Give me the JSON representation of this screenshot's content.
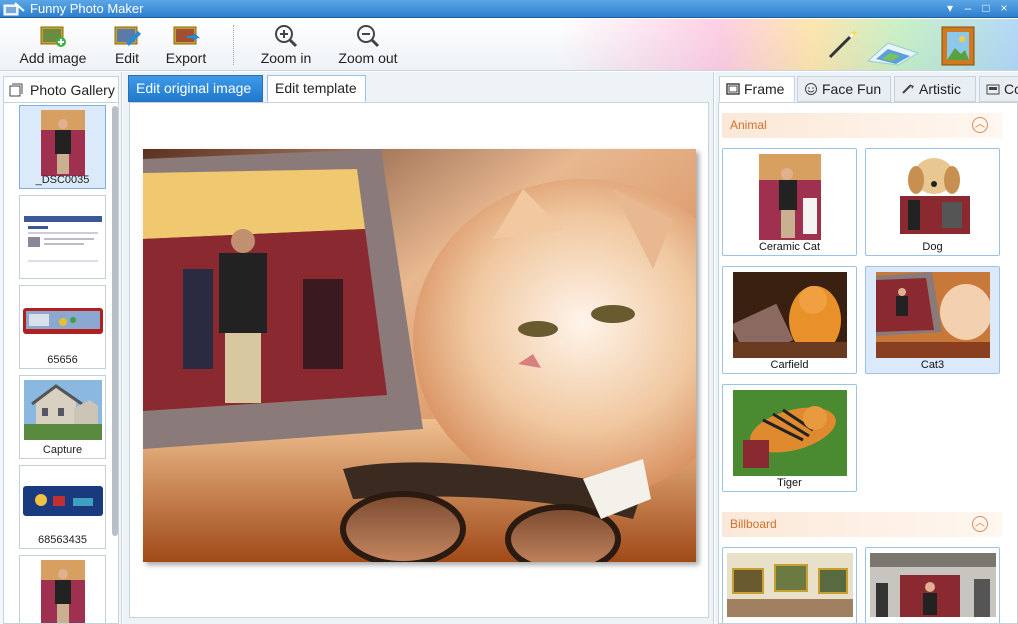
{
  "window": {
    "title": "Funny Photo Maker",
    "controls": [
      "▾",
      "–",
      "□",
      "×"
    ]
  },
  "toolbar": {
    "add_image": "Add image",
    "edit": "Edit",
    "export": "Export",
    "zoom_in": "Zoom in",
    "zoom_out": "Zoom out"
  },
  "gallery": {
    "tab_label": "Photo Gallery",
    "items": [
      {
        "caption": "_DSC0035",
        "selected": true
      },
      {
        "caption": "",
        "selected": false
      },
      {
        "caption": "65656",
        "selected": false
      },
      {
        "caption": "Capture",
        "selected": false
      },
      {
        "caption": "68563435",
        "selected": false
      },
      {
        "caption": "",
        "selected": false
      }
    ]
  },
  "editor": {
    "tab_original": "Edit original image",
    "tab_template": "Edit template"
  },
  "templates": {
    "tabs": [
      {
        "label": "Frame",
        "icon": "frame-icon",
        "active": true
      },
      {
        "label": "Face Fun",
        "icon": "smiley-icon",
        "active": false
      },
      {
        "label": "Artistic",
        "icon": "brush-icon",
        "active": false
      },
      {
        "label": "Co",
        "icon": "cover-icon",
        "active": false
      }
    ],
    "sections": [
      {
        "title": "Animal",
        "items": [
          {
            "label": "Ceramic Cat",
            "selected": false
          },
          {
            "label": "Dog",
            "selected": false
          },
          {
            "label": "Carfield",
            "selected": false
          },
          {
            "label": "Cat3",
            "selected": true
          },
          {
            "label": "Tiger",
            "selected": false
          }
        ]
      },
      {
        "title": "Billboard",
        "items": [
          {
            "label": "",
            "selected": false
          },
          {
            "label": "",
            "selected": false
          }
        ]
      }
    ]
  },
  "colors": {
    "titlebar": "#2f7fcf",
    "active_tab": "#1f79cf",
    "section_title": "#d0702a"
  }
}
